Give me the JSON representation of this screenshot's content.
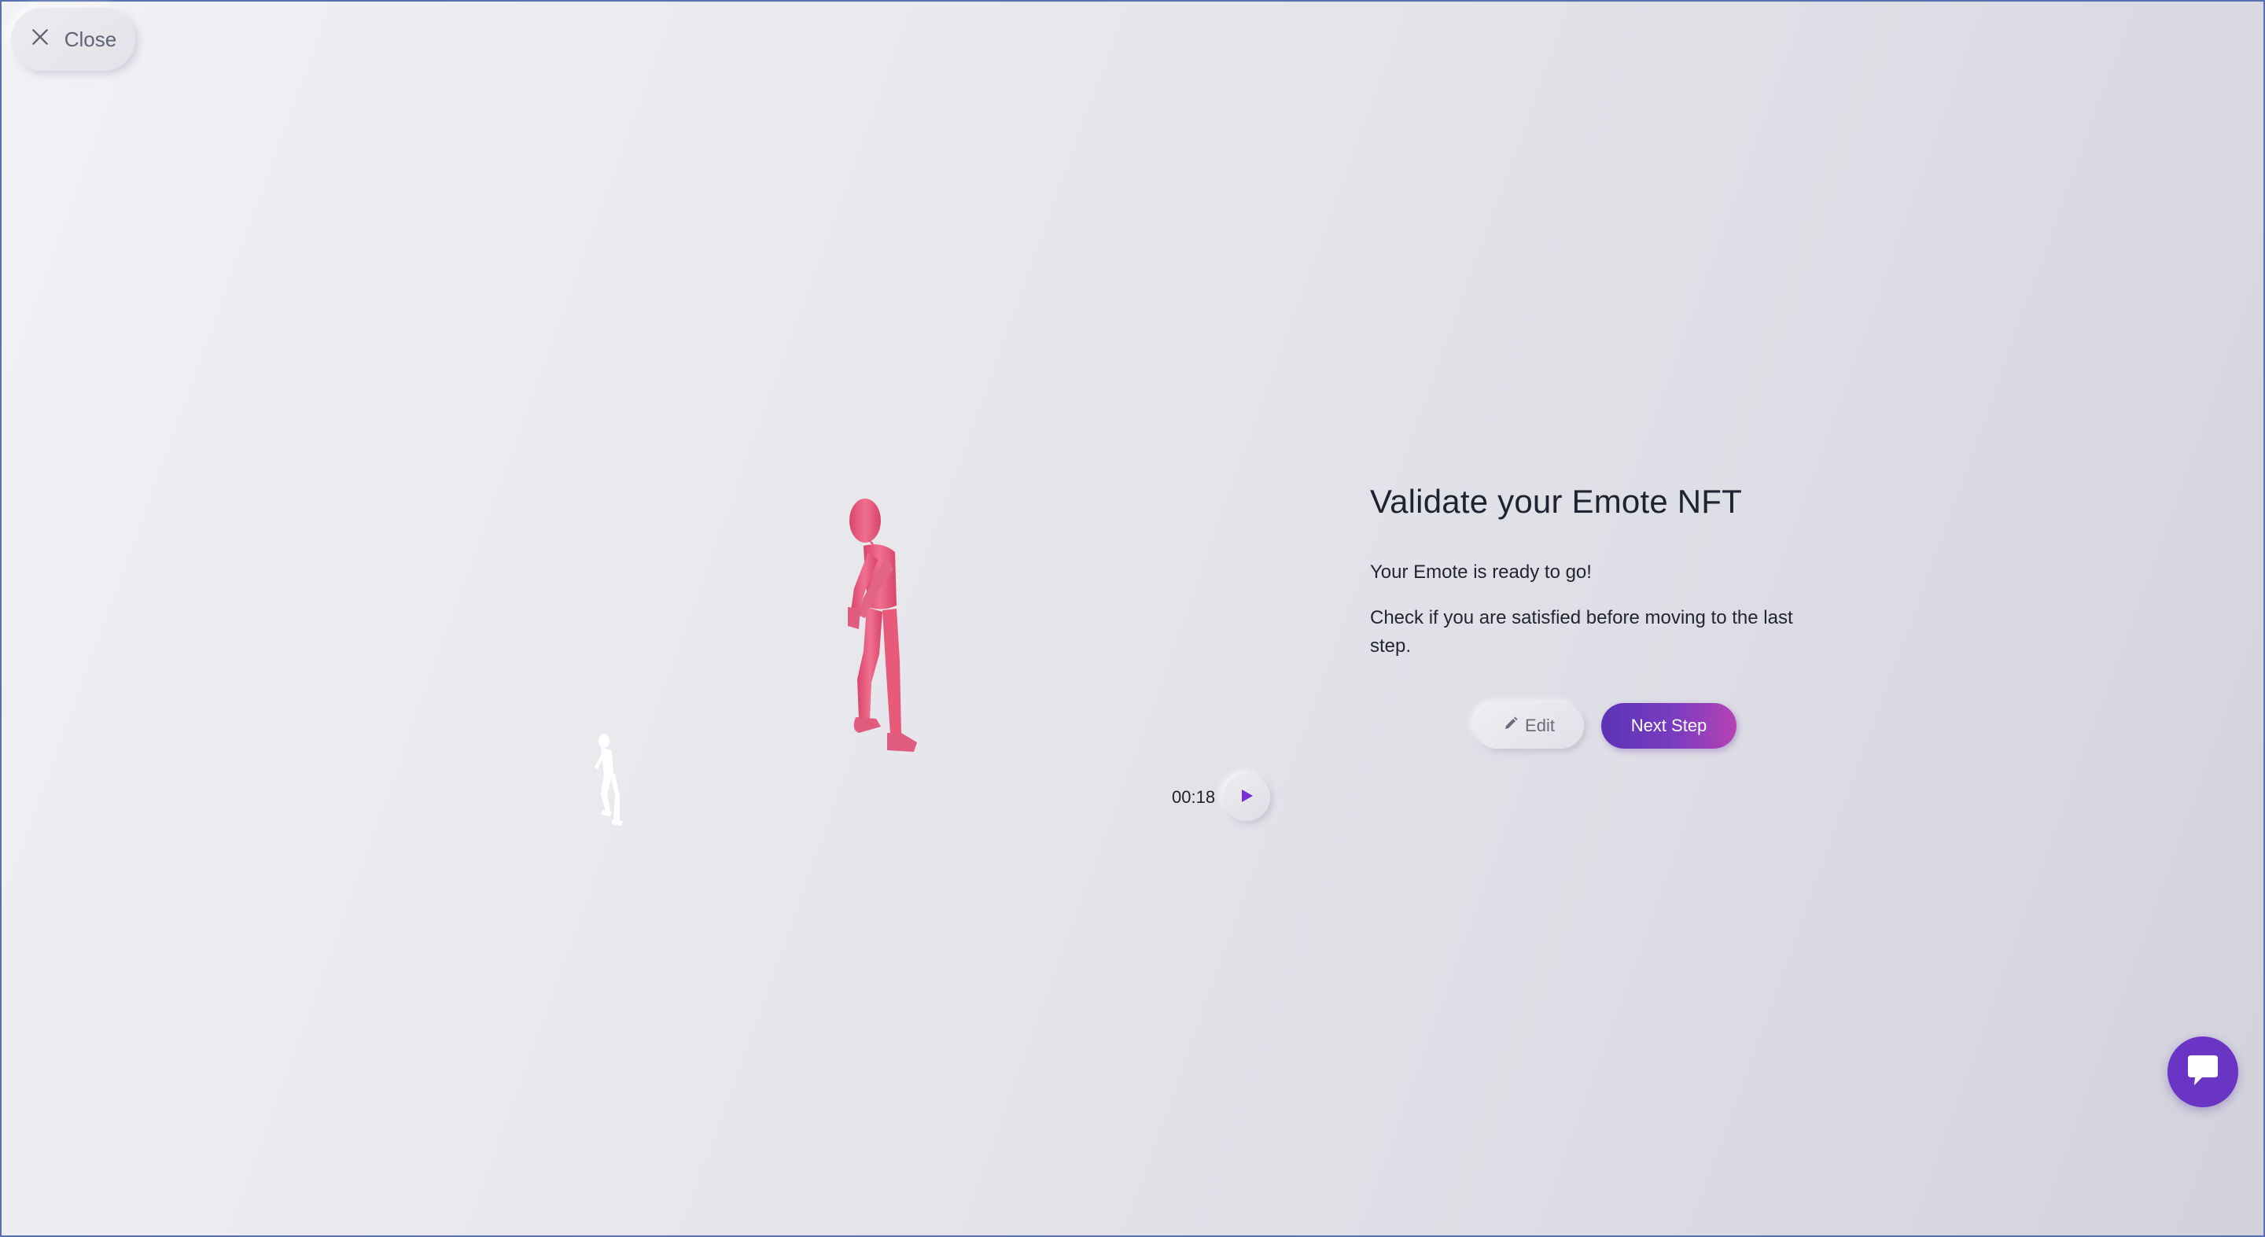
{
  "header": {
    "close_label": "Close",
    "close_icon": "close-icon"
  },
  "preview": {
    "time": "00:18",
    "play_icon": "play-icon",
    "figure_color": "#e85a7a",
    "shadow_figure_color": "#ffffff"
  },
  "panel": {
    "title": "Validate your Emote NFT",
    "message_ready": "Your Emote is ready to go!",
    "message_check": "Check if you are satisfied before moving to the last step.",
    "edit_label": "Edit",
    "edit_icon": "pencil-icon",
    "next_label": "Next Step"
  },
  "chat": {
    "icon": "chat-icon",
    "color": "#6a35c4"
  },
  "colors": {
    "accent_start": "#5b33b6",
    "accent_end": "#b642b5"
  }
}
